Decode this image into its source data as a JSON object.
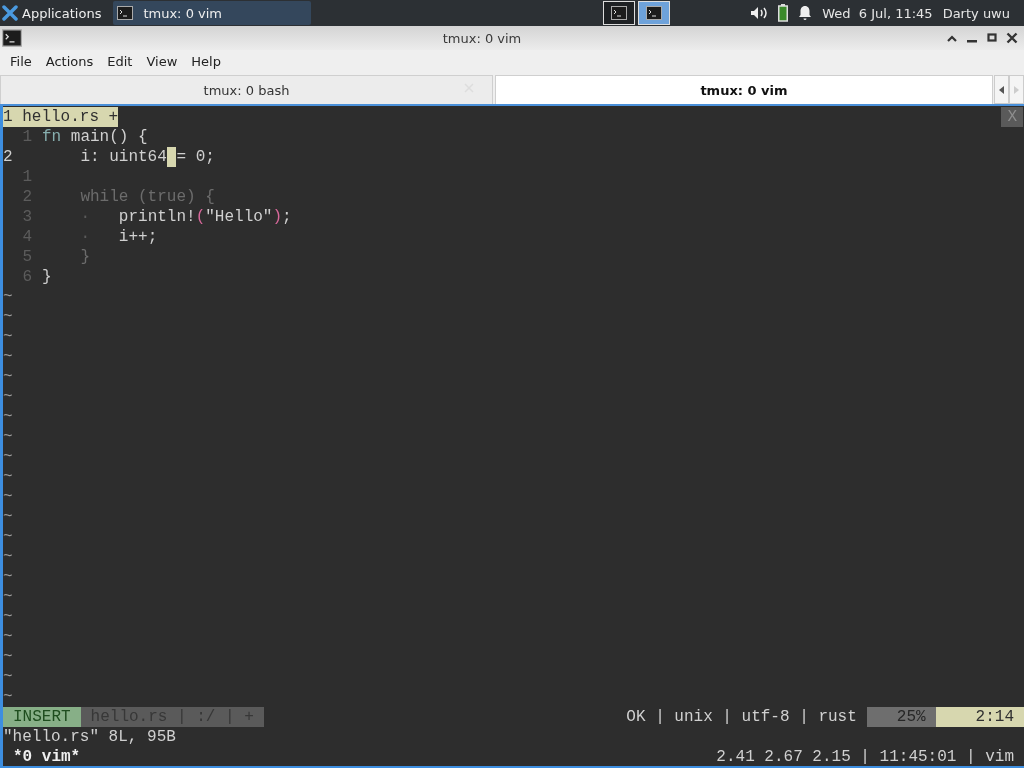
{
  "top_panel": {
    "applications": "Applications",
    "taskbar": [
      {
        "title": "tmux: 0 vim",
        "selected": true
      }
    ],
    "workspaces": [
      {
        "selected": false
      },
      {
        "selected": true
      }
    ],
    "clock": "Wed  6 Jul, 11:45",
    "user": "Darty uwu"
  },
  "window": {
    "title": "tmux: 0 vim",
    "menu": [
      "File",
      "Actions",
      "Edit",
      "View",
      "Help"
    ],
    "tabs": [
      {
        "label": "tmux: 0 bash",
        "selected": false
      },
      {
        "label": "tmux: 0 vim",
        "selected": true
      }
    ]
  },
  "terminal": {
    "tabline": {
      "buffer": "1 hello.rs +",
      "close": "X"
    },
    "lines": [
      {
        "number": "1",
        "current": false,
        "tokens": [
          {
            "text": "fn",
            "kind": "keyword"
          },
          {
            "text": " main() {",
            "kind": "plain"
          }
        ]
      },
      {
        "number": "2",
        "current": true,
        "tokens": [
          {
            "text": "    i: uint64",
            "kind": "plain"
          },
          {
            "kind": "cursor"
          },
          {
            "text": "= 0;",
            "kind": "plain"
          }
        ]
      },
      {
        "number": "1",
        "current": false
      },
      {
        "number": "2",
        "current": false,
        "tokens": [
          {
            "text": "    while (true) {",
            "kind": "dim"
          }
        ]
      },
      {
        "number": "3",
        "current": false,
        "tokens": [
          {
            "text": "    ·",
            "kind": "guide"
          },
          {
            "text": "   println!",
            "kind": "plain"
          },
          {
            "text": "(",
            "kind": "paren"
          },
          {
            "text": "\"Hello\"",
            "kind": "plain"
          },
          {
            "text": ")",
            "kind": "paren"
          },
          {
            "text": ";",
            "kind": "plain"
          }
        ]
      },
      {
        "number": "4",
        "current": false,
        "tokens": [
          {
            "text": "    ·",
            "kind": "guide"
          },
          {
            "text": "   i++;",
            "kind": "plain"
          }
        ]
      },
      {
        "number": "5",
        "current": false,
        "tokens": [
          {
            "text": "    }",
            "kind": "dim"
          }
        ]
      },
      {
        "number": "6",
        "current": false,
        "tokens": [
          {
            "text": "}",
            "kind": "plain"
          }
        ]
      }
    ],
    "empty_lines": [
      "~",
      "~",
      "~",
      "~",
      "~",
      "~",
      "~",
      "~",
      "~",
      "~",
      "~",
      "~",
      "~",
      "~",
      "~",
      "~",
      "~",
      "~",
      "~",
      "~",
      "~"
    ],
    "statusline": {
      "mode": "INSERT",
      "file": "hello.rs | :/ | +",
      "info": "OK | unix | utf-8 | rust",
      "percent": "25%",
      "position": "2:14"
    },
    "message": "\"hello.rs\" 8L, 95B",
    "tmux_status": {
      "window": "*0 vim*",
      "info": "2.41 2.67 2.15 | 11:45:01 | vim"
    }
  }
}
